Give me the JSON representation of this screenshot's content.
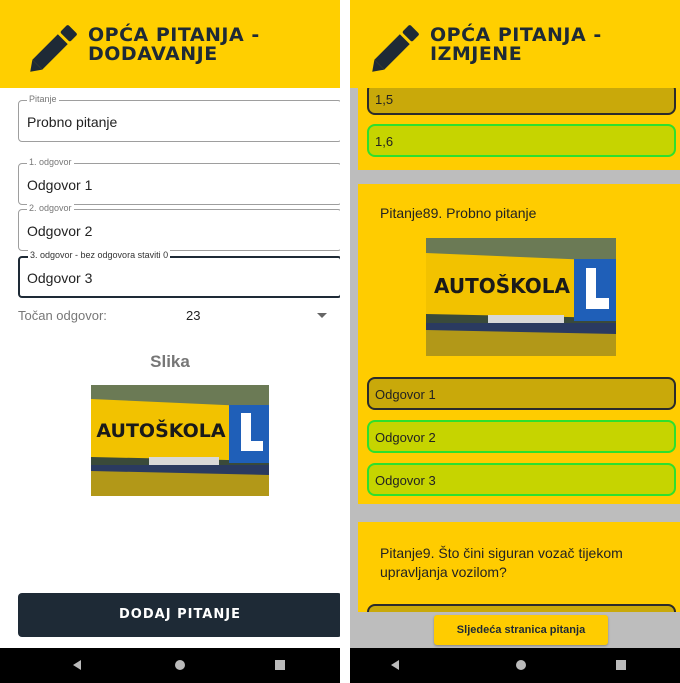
{
  "left_screen": {
    "title_line1": "OPĆA PITANJA -",
    "title_line2": "DODAVANJE",
    "fields": {
      "pitanje": {
        "label": "Pitanje",
        "value": "Probno pitanje"
      },
      "odgovor1": {
        "label": "1. odgovor",
        "value": "Odgovor 1"
      },
      "odgovor2": {
        "label": "2. odgovor",
        "value": "Odgovor 2"
      },
      "odgovor3": {
        "label": "3. odgovor - bez odgovora staviti 0",
        "value": "Odgovor 3"
      }
    },
    "correct_answer": {
      "label": "Točan odgovor:",
      "value": "23"
    },
    "image_section_label": "Slika",
    "image_sign_text": "AUTOŠKOLA",
    "image_sign_letter": "L",
    "add_button_label": "DODAJ PITANJE"
  },
  "right_screen": {
    "title_line1": "OPĆA PITANJA -",
    "title_line2": "IZMJENE",
    "top_options": [
      "1,5",
      "1,6"
    ],
    "question1": {
      "text": "Pitanje89. Probno pitanje",
      "answers": [
        "Odgovor 1",
        "Odgovor 2",
        "Odgovor 3"
      ]
    },
    "question2": {
      "text_line1": "Pitanje9. Što čini siguran vozač tijekom",
      "text_line2": "upravljanja vozilom?"
    },
    "image_sign_text": "AUTOŠKOLA",
    "image_sign_letter": "L",
    "next_page_button": "Sljedeća stranica pitanja"
  },
  "colors": {
    "accent_yellow": "#ffcf00",
    "dark_navy": "#1e2a36",
    "correct_green_border": "#2de02d",
    "answer_green_fill": "#c6d400",
    "answer_dark_fill": "#c9a90a"
  },
  "icons": [
    "pencil-icon",
    "nav-back-icon",
    "nav-home-icon",
    "nav-recents-icon",
    "dropdown-caret-icon"
  ]
}
